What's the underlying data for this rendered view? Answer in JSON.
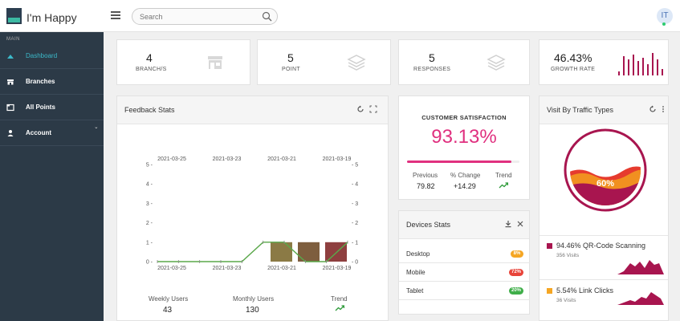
{
  "app": {
    "title": "I'm Happy",
    "avatar_initials": "IT"
  },
  "search": {
    "placeholder": "Search"
  },
  "sidebar": {
    "section_label": "MAIN",
    "items": [
      {
        "label": "Dashboard",
        "icon": "dashboard-icon",
        "active": true
      },
      {
        "label": "Branches",
        "icon": "store-icon"
      },
      {
        "label": "All Points",
        "icon": "points-icon"
      },
      {
        "label": "Account",
        "icon": "user-icon",
        "caret": "ˇ"
      }
    ]
  },
  "stats": [
    {
      "value": "4",
      "label": "BRANCH/S",
      "icon": "store-icon"
    },
    {
      "value": "5",
      "label": "POINT",
      "icon": "layers-icon"
    },
    {
      "value": "5",
      "label": "RESPONSES",
      "icon": "layers-icon"
    },
    {
      "value": "46.43%",
      "label": "GROWTH RATE",
      "icon": "bar-sparkline",
      "color": "#a8154f"
    }
  ],
  "feedback": {
    "title": "Feedback Stats",
    "footer": [
      {
        "label": "Weekly Users",
        "value": "43"
      },
      {
        "label": "Monthly Users",
        "value": "130"
      },
      {
        "label": "Trend",
        "icon": "trend-up-icon"
      }
    ]
  },
  "chart_data": {
    "type": "bar",
    "x_top": [
      "2021-03-25",
      "2021-03-23",
      "2021-03-21",
      "2021-03-19"
    ],
    "x_bottom": [
      "2021-03-25",
      "2021-03-23",
      "2021-03-21",
      "2021-03-19"
    ],
    "y_ticks": [
      0,
      1,
      2,
      3,
      4,
      5
    ],
    "ylim": [
      0,
      5
    ],
    "bars": [
      {
        "category": "2021-03-21",
        "value": 1,
        "color": "#8b7a45"
      },
      {
        "category": "2021-03-20",
        "value": 1,
        "color": "#7e5e3e"
      },
      {
        "category": "2021-03-19",
        "value": 1,
        "color": "#8e3f3f"
      }
    ],
    "line": {
      "color": "#5aa84a",
      "points": [
        0,
        0,
        0,
        0,
        0,
        1,
        1,
        0,
        0,
        1
      ]
    },
    "grid": false
  },
  "satisfaction": {
    "title": "CUSTOMER SATISFACTION",
    "value": "93.13%",
    "progress": 0.9313,
    "color": "#e0307f",
    "stats": [
      {
        "label": "Previous",
        "value": "79.82"
      },
      {
        "label": "% Change",
        "value": "+14.29"
      },
      {
        "label": "Trend",
        "icon": "trend-up-icon"
      }
    ]
  },
  "devices": {
    "title": "Devices Stats",
    "rows": [
      {
        "name": "Desktop",
        "badge": "8%",
        "color": "#f5a623"
      },
      {
        "name": "Mobile",
        "badge": "72%",
        "color": "#e8443a"
      },
      {
        "name": "Tablet",
        "badge": "20%",
        "color": "#3fae49"
      }
    ]
  },
  "traffic": {
    "title": "Visit By Traffic Types",
    "gauge_value": "60%",
    "gauge_fraction": 0.6,
    "items": [
      {
        "title": "94.46% QR-Code Scanning",
        "sub": "356 Visits",
        "color": "#a8154f"
      },
      {
        "title": "5.54% Link Clicks",
        "sub": "36 Visits",
        "color": "#f5a623"
      }
    ]
  }
}
